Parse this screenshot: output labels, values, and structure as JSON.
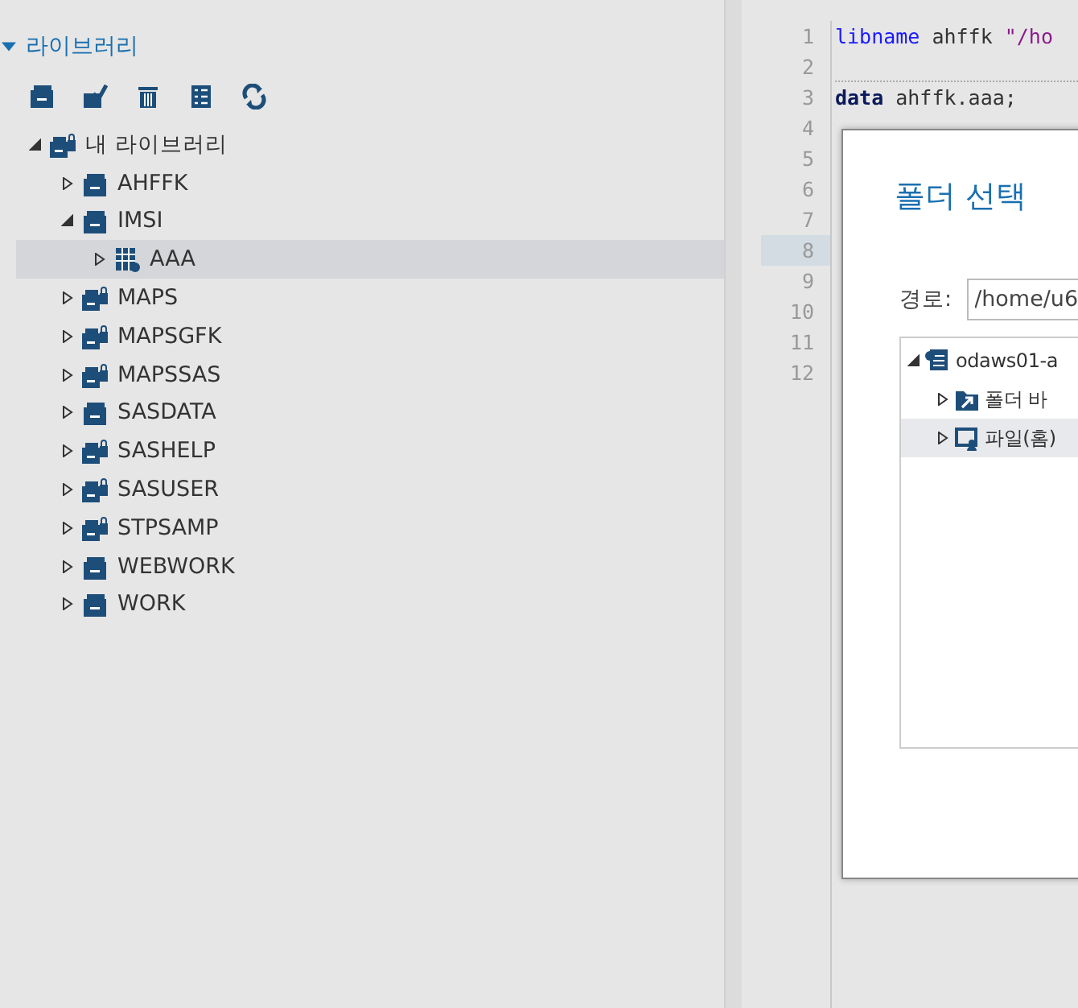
{
  "sidebar": {
    "section": {
      "label": "라이브러리",
      "expanded": true
    },
    "tree": [
      {
        "label": "내 라이브러리",
        "kind": "locked",
        "expanded": true,
        "selected": false,
        "children": [
          {
            "label": "AHFFK",
            "kind": "plain",
            "expanded": false,
            "selected": false
          },
          {
            "label": "IMSI",
            "kind": "plain",
            "expanded": true,
            "selected": false,
            "children": [
              {
                "label": "AAA",
                "kind": "table",
                "expanded": false,
                "selected": true
              }
            ]
          },
          {
            "label": "MAPS",
            "kind": "locked",
            "expanded": false,
            "selected": false
          },
          {
            "label": "MAPSGFK",
            "kind": "locked",
            "expanded": false,
            "selected": false
          },
          {
            "label": "MAPSSAS",
            "kind": "locked",
            "expanded": false,
            "selected": false
          },
          {
            "label": "SASDATA",
            "kind": "plain",
            "expanded": false,
            "selected": false
          },
          {
            "label": "SASHELP",
            "kind": "locked",
            "expanded": false,
            "selected": false
          },
          {
            "label": "SASUSER",
            "kind": "locked",
            "expanded": false,
            "selected": false
          },
          {
            "label": "STPSAMP",
            "kind": "locked",
            "expanded": false,
            "selected": false
          },
          {
            "label": "WEBWORK",
            "kind": "plain",
            "expanded": false,
            "selected": false
          },
          {
            "label": "WORK",
            "kind": "plain",
            "expanded": false,
            "selected": false
          }
        ]
      }
    ]
  },
  "editor": {
    "lines": [
      {
        "number": "1",
        "parts": [
          {
            "kind": "keyword",
            "text": "libname"
          },
          {
            "kind": "plain",
            "text": " ahffk "
          },
          {
            "kind": "string",
            "text": "\"/ho"
          }
        ],
        "current": false
      },
      {
        "number": "2",
        "current": false
      },
      {
        "number": "3",
        "parts": [
          {
            "kind": "step",
            "text": "data"
          },
          {
            "kind": "plain",
            "text": " ahffk.aaa;"
          }
        ],
        "current": false
      },
      {
        "number": "4",
        "current": false
      },
      {
        "number": "5",
        "current": false
      },
      {
        "number": "6",
        "current": false
      },
      {
        "number": "7",
        "current": false
      },
      {
        "number": "8",
        "current": true
      },
      {
        "number": "9",
        "current": false
      },
      {
        "number": "10",
        "current": false
      },
      {
        "number": "11",
        "current": false
      },
      {
        "number": "12",
        "current": false
      }
    ]
  },
  "dialog": {
    "title": "폴더 선택",
    "path_label": "경로:",
    "path_value": "/home/u6",
    "tree": [
      {
        "label": "odaws01-a",
        "kind": "server",
        "expanded": true,
        "selected": false,
        "children": [
          {
            "label": "폴더 바",
            "kind": "shortcut",
            "expanded": false,
            "selected": false
          },
          {
            "label": "파일(홈)",
            "kind": "home",
            "expanded": false,
            "selected": true
          }
        ]
      }
    ]
  }
}
